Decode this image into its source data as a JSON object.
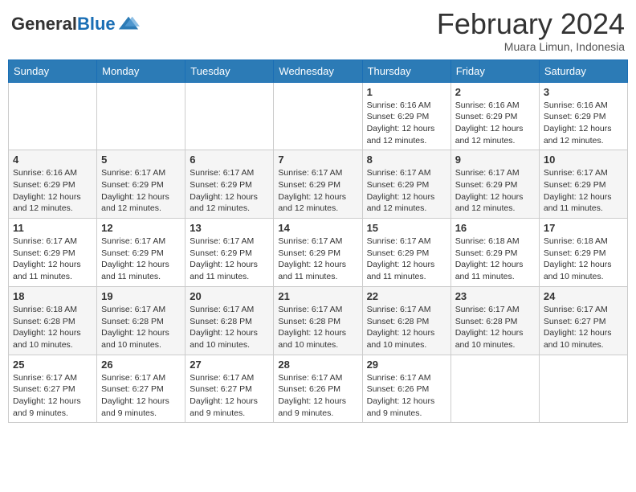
{
  "header": {
    "logo_general": "General",
    "logo_blue": "Blue",
    "title": "February 2024",
    "subtitle": "Muara Limun, Indonesia"
  },
  "weekdays": [
    "Sunday",
    "Monday",
    "Tuesday",
    "Wednesday",
    "Thursday",
    "Friday",
    "Saturday"
  ],
  "weeks": [
    [
      {
        "day": "",
        "info": ""
      },
      {
        "day": "",
        "info": ""
      },
      {
        "day": "",
        "info": ""
      },
      {
        "day": "",
        "info": ""
      },
      {
        "day": "1",
        "info": "Sunrise: 6:16 AM\nSunset: 6:29 PM\nDaylight: 12 hours and 12 minutes."
      },
      {
        "day": "2",
        "info": "Sunrise: 6:16 AM\nSunset: 6:29 PM\nDaylight: 12 hours and 12 minutes."
      },
      {
        "day": "3",
        "info": "Sunrise: 6:16 AM\nSunset: 6:29 PM\nDaylight: 12 hours and 12 minutes."
      }
    ],
    [
      {
        "day": "4",
        "info": "Sunrise: 6:16 AM\nSunset: 6:29 PM\nDaylight: 12 hours and 12 minutes."
      },
      {
        "day": "5",
        "info": "Sunrise: 6:17 AM\nSunset: 6:29 PM\nDaylight: 12 hours and 12 minutes."
      },
      {
        "day": "6",
        "info": "Sunrise: 6:17 AM\nSunset: 6:29 PM\nDaylight: 12 hours and 12 minutes."
      },
      {
        "day": "7",
        "info": "Sunrise: 6:17 AM\nSunset: 6:29 PM\nDaylight: 12 hours and 12 minutes."
      },
      {
        "day": "8",
        "info": "Sunrise: 6:17 AM\nSunset: 6:29 PM\nDaylight: 12 hours and 12 minutes."
      },
      {
        "day": "9",
        "info": "Sunrise: 6:17 AM\nSunset: 6:29 PM\nDaylight: 12 hours and 12 minutes."
      },
      {
        "day": "10",
        "info": "Sunrise: 6:17 AM\nSunset: 6:29 PM\nDaylight: 12 hours and 11 minutes."
      }
    ],
    [
      {
        "day": "11",
        "info": "Sunrise: 6:17 AM\nSunset: 6:29 PM\nDaylight: 12 hours and 11 minutes."
      },
      {
        "day": "12",
        "info": "Sunrise: 6:17 AM\nSunset: 6:29 PM\nDaylight: 12 hours and 11 minutes."
      },
      {
        "day": "13",
        "info": "Sunrise: 6:17 AM\nSunset: 6:29 PM\nDaylight: 12 hours and 11 minutes."
      },
      {
        "day": "14",
        "info": "Sunrise: 6:17 AM\nSunset: 6:29 PM\nDaylight: 12 hours and 11 minutes."
      },
      {
        "day": "15",
        "info": "Sunrise: 6:17 AM\nSunset: 6:29 PM\nDaylight: 12 hours and 11 minutes."
      },
      {
        "day": "16",
        "info": "Sunrise: 6:18 AM\nSunset: 6:29 PM\nDaylight: 12 hours and 11 minutes."
      },
      {
        "day": "17",
        "info": "Sunrise: 6:18 AM\nSunset: 6:29 PM\nDaylight: 12 hours and 10 minutes."
      }
    ],
    [
      {
        "day": "18",
        "info": "Sunrise: 6:18 AM\nSunset: 6:28 PM\nDaylight: 12 hours and 10 minutes."
      },
      {
        "day": "19",
        "info": "Sunrise: 6:17 AM\nSunset: 6:28 PM\nDaylight: 12 hours and 10 minutes."
      },
      {
        "day": "20",
        "info": "Sunrise: 6:17 AM\nSunset: 6:28 PM\nDaylight: 12 hours and 10 minutes."
      },
      {
        "day": "21",
        "info": "Sunrise: 6:17 AM\nSunset: 6:28 PM\nDaylight: 12 hours and 10 minutes."
      },
      {
        "day": "22",
        "info": "Sunrise: 6:17 AM\nSunset: 6:28 PM\nDaylight: 12 hours and 10 minutes."
      },
      {
        "day": "23",
        "info": "Sunrise: 6:17 AM\nSunset: 6:28 PM\nDaylight: 12 hours and 10 minutes."
      },
      {
        "day": "24",
        "info": "Sunrise: 6:17 AM\nSunset: 6:27 PM\nDaylight: 12 hours and 10 minutes."
      }
    ],
    [
      {
        "day": "25",
        "info": "Sunrise: 6:17 AM\nSunset: 6:27 PM\nDaylight: 12 hours and 9 minutes."
      },
      {
        "day": "26",
        "info": "Sunrise: 6:17 AM\nSunset: 6:27 PM\nDaylight: 12 hours and 9 minutes."
      },
      {
        "day": "27",
        "info": "Sunrise: 6:17 AM\nSunset: 6:27 PM\nDaylight: 12 hours and 9 minutes."
      },
      {
        "day": "28",
        "info": "Sunrise: 6:17 AM\nSunset: 6:26 PM\nDaylight: 12 hours and 9 minutes."
      },
      {
        "day": "29",
        "info": "Sunrise: 6:17 AM\nSunset: 6:26 PM\nDaylight: 12 hours and 9 minutes."
      },
      {
        "day": "",
        "info": ""
      },
      {
        "day": "",
        "info": ""
      }
    ]
  ]
}
